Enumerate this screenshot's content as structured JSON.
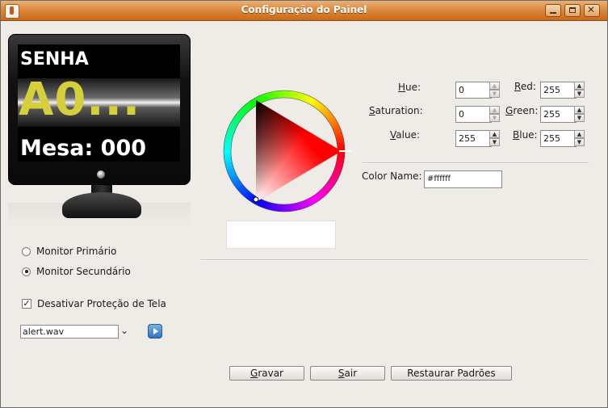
{
  "window": {
    "title": "Configuração do Painel"
  },
  "monitor": {
    "label_senha": "SENHA",
    "code": "A0...",
    "mesa": "Mesa: 000"
  },
  "options": {
    "monitor_primary": "Monitor Primário",
    "monitor_secondary": "Monitor Secundário",
    "selected": "Monitor Secundário",
    "disable_screensaver": "Desativar Proteção de Tela",
    "disable_screensaver_checked": true,
    "sound_file": "alert.wav"
  },
  "color_chooser": {
    "hue_label": "Hue:",
    "hue": "0",
    "saturation_label": "Saturation:",
    "saturation": "0",
    "value_label": "Value:",
    "value": "255",
    "red_label": "Red:",
    "red": "255",
    "green_label": "Green:",
    "green": "255",
    "blue_label": "Blue:",
    "blue": "255",
    "color_name_label": "Color Name:",
    "color_name": "#ffffff",
    "current_color": "#ffffff"
  },
  "buttons": {
    "save": "Gravar",
    "exit": "Sair",
    "restore": "Restaurar Padrões"
  },
  "colors": {
    "titlebar": "#dc8a3c",
    "code_yellow": "#d4cf3a",
    "window_bg": "#efebe7"
  }
}
